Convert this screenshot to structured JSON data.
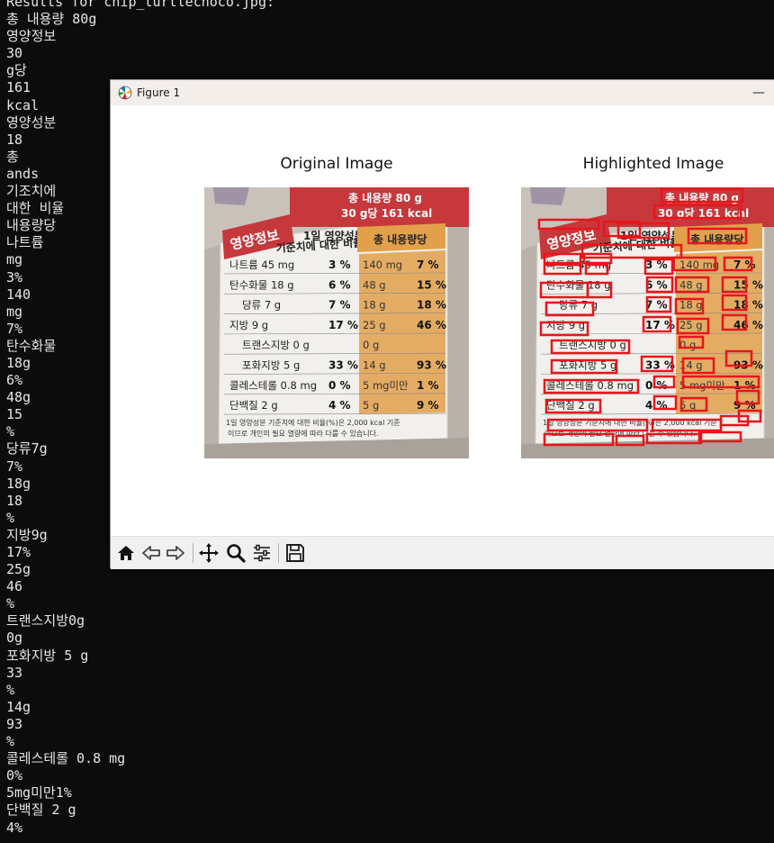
{
  "terminal": {
    "lines": [
      "Results for chip_turtlechoco.jpg:",
      "총 내용량 80g",
      "영양정보",
      "30",
      "g당",
      "161",
      "kcal",
      "영양성분",
      "18",
      "총",
      "ands",
      "기조치에",
      "대한 비율",
      "내용량당",
      "나트륨",
      "mg",
      "3%",
      "140",
      "mg",
      "7%",
      "탄수화물",
      "18g",
      "6%",
      "48g",
      "15",
      "%",
      "당류7g",
      "7%",
      "18g",
      "18",
      "%",
      "지방9g",
      "17%",
      "25g",
      "46",
      "%",
      "트랜스지방0g",
      "0g",
      "포화지방 5 g",
      "33",
      "%",
      "14g",
      "93",
      "%",
      "콜레스테롤 0.8 mg",
      "0%",
      "5mg미만1%",
      "단백질 2 g",
      "4%"
    ]
  },
  "window": {
    "title": "Figure 1",
    "minimize": "—"
  },
  "figure": {
    "left_title": "Original Image",
    "right_title": "Highlighted Image"
  },
  "label": {
    "total": "총 내용량 80 g",
    "serving": "30 g당 161 kcal",
    "title": "영양정보",
    "col1a": "1일 영양성분",
    "col1b": "기준치에 대한 비율",
    "col2": "총 내용량당",
    "footer1": "1일 영양성분 기준치에 대한 비율(%)은 2,000 kcal 기준",
    "footer2": "이므로 개인의 필요 열량에 따라 다를 수 있습니다.",
    "rows": [
      {
        "name": "나트륨 45 mg",
        "pct": "3 %",
        "amt": "140 mg",
        "apct": "7 %"
      },
      {
        "name": "탄수화물 18 g",
        "pct": "6 %",
        "amt": "48 g",
        "apct": "15 %"
      },
      {
        "name": "당류 7 g",
        "pct": "7 %",
        "amt": "18 g",
        "apct": "18 %"
      },
      {
        "name": "지방 9 g",
        "pct": "17 %",
        "amt": "25 g",
        "apct": "46 %"
      },
      {
        "name": "트랜스지방 0 g",
        "pct": "",
        "amt": "0 g",
        "apct": ""
      },
      {
        "name": "포화지방 5 g",
        "pct": "33 %",
        "amt": "14 g",
        "apct": "93 %"
      },
      {
        "name": "콜레스테롤 0.8 mg",
        "pct": "0 %",
        "amt": "5 mg미만",
        "apct": "1 %"
      },
      {
        "name": "단백질 2 g",
        "pct": "4 %",
        "amt": "5 g",
        "apct": "9 %"
      }
    ]
  },
  "toolbar": [
    "home-icon",
    "back-icon",
    "forward-icon",
    "pan-icon",
    "zoom-icon",
    "configure-subplots-icon",
    "save-icon"
  ],
  "colors": {
    "terminal_bg": "#0c0c0c",
    "terminal_fg": "#e6e6e6",
    "titlebar_bg": "#f3eeea",
    "highlight_box": "#e8151b",
    "label_orange": "#e2a04a",
    "label_bg": "#f2f0ec",
    "label_red": "#c6383c"
  }
}
